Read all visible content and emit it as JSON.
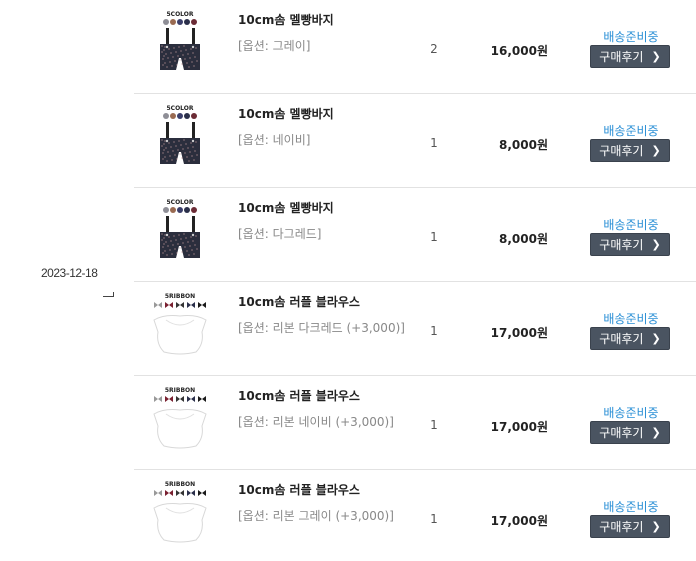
{
  "order": {
    "date": "2023-12-18"
  },
  "items": [
    {
      "title": "10cm솜 멜빵바지",
      "option": "[옵션: 그레이]",
      "qty": "2",
      "price": "16,000원",
      "status": "배송준비중",
      "review_label": "구매후기",
      "thumb_type": "overalls",
      "thumb_caption": "5COLOR"
    },
    {
      "title": "10cm솜 멜빵바지",
      "option": "[옵션: 네이비]",
      "qty": "1",
      "price": "8,000원",
      "status": "배송준비중",
      "review_label": "구매후기",
      "thumb_type": "overalls",
      "thumb_caption": "5COLOR"
    },
    {
      "title": "10cm솜 멜빵바지",
      "option": "[옵션: 다그레드]",
      "qty": "1",
      "price": "8,000원",
      "status": "배송준비중",
      "review_label": "구매후기",
      "thumb_type": "overalls",
      "thumb_caption": "5COLOR"
    },
    {
      "title": "10cm솜 러플 블라우스",
      "option": "[옵션: 리본 다크레드 (+3,000)]",
      "qty": "1",
      "price": "17,000원",
      "status": "배송준비중",
      "review_label": "구매후기",
      "thumb_type": "blouse",
      "thumb_caption": "5RIBBON"
    },
    {
      "title": "10cm솜 러플 블라우스",
      "option": "[옵션: 리본 네이비 (+3,000)]",
      "qty": "1",
      "price": "17,000원",
      "status": "배송준비중",
      "review_label": "구매후기",
      "thumb_type": "blouse",
      "thumb_caption": "5RIBBON"
    },
    {
      "title": "10cm솜 러플 블라우스",
      "option": "[옵션: 리본 그레이 (+3,000)]",
      "qty": "1",
      "price": "17,000원",
      "status": "배송준비중",
      "review_label": "구매후기",
      "thumb_type": "blouse",
      "thumb_caption": "5RIBBON"
    }
  ],
  "colors": {
    "status_blue": "#2a8fd6",
    "button_bg": "#4a5461",
    "divider": "#e2e2e2"
  }
}
